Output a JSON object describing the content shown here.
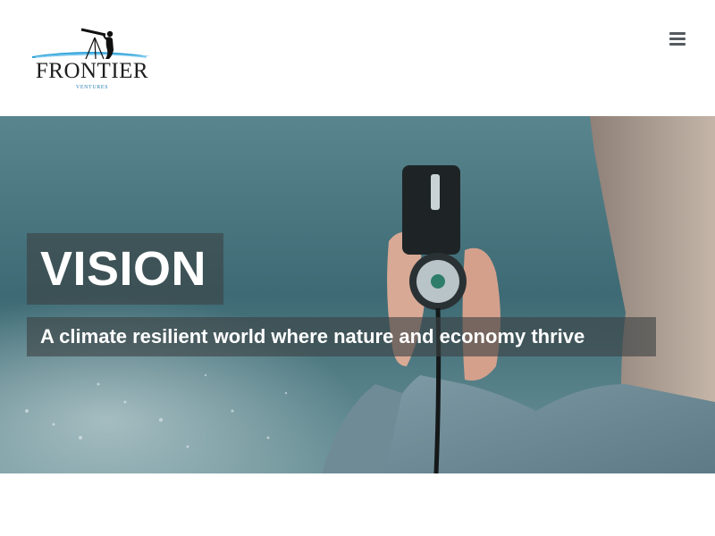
{
  "header": {
    "logo_name": "FRONTIER",
    "logo_sub": "VENTURES",
    "menu_icon": "hamburger-menu-icon"
  },
  "hero": {
    "title": "VISION",
    "subtitle": "A climate resilient world where nature and economy thrive"
  },
  "colors": {
    "overlay": "#3c4244",
    "text": "#ffffff",
    "menu_icon": "#555a5f",
    "logo_accent": "#2a7fb5"
  }
}
